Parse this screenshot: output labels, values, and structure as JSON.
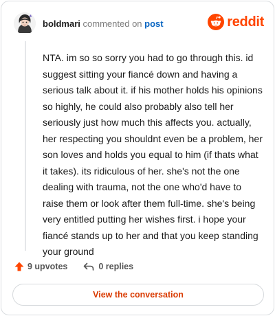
{
  "header": {
    "username": "boldmari",
    "action": "commented on",
    "post_link": "post",
    "brand": "reddit"
  },
  "comment": {
    "text": "NTA. im so so sorry you had to go through this. id suggest sitting your fiancé down and having a serious talk about it. if his mother holds his opinions so highly, he could also probably also tell her seriously just how much this affects you. actually, her respecting you shouldnt even be a problem, her son loves and holds you equal to him (if thats what it takes). its ridiculous of her. she's not the one dealing with trauma, not the one who'd have to raise them or look after them full-time. she's being very entitled putting her wishes first. i hope your fiancé stands up to her and that you keep standing your ground"
  },
  "actions": {
    "upvotes_label": "9 upvotes",
    "replies_label": "0 replies"
  },
  "cta": {
    "label": "View the conversation"
  },
  "colors": {
    "brand": "#ff4500",
    "link": "#0a66c2",
    "cta_text": "#d93a00",
    "upvote": "#ff4500"
  },
  "icons": {
    "logo": "reddit-snoo-icon",
    "upvote": "upvote-arrow-icon",
    "reply": "reply-arrow-icon"
  }
}
